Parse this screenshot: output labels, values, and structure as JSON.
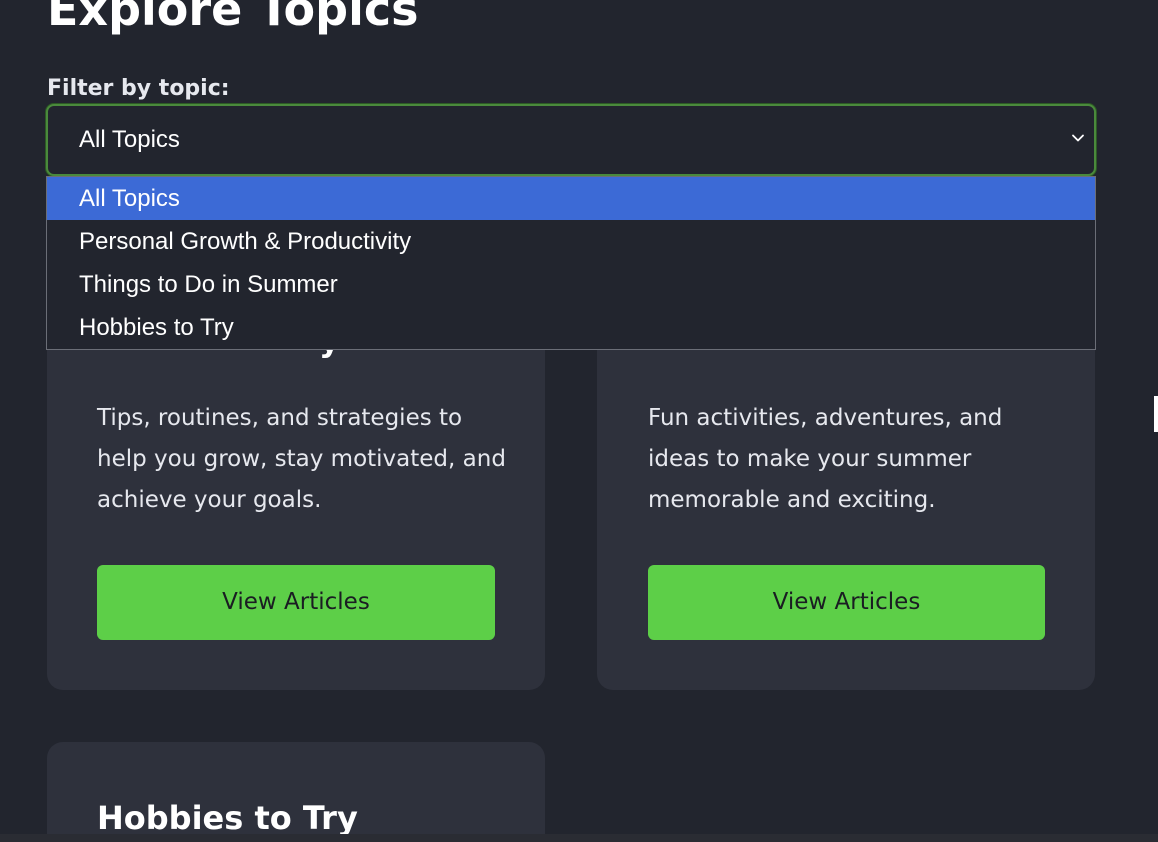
{
  "page": {
    "title": "Explore Topics"
  },
  "filter": {
    "label": "Filter by topic:",
    "selected_value": "All Topics",
    "options": [
      "All Topics",
      "Personal Growth & Productivity",
      "Things to Do in Summer",
      "Hobbies to Try"
    ]
  },
  "cards": [
    {
      "description_lines": [
        "Tips, routines, and strategies to",
        "help you grow, stay motivated, and",
        "achieve your goals."
      ],
      "button_label": "View Articles"
    },
    {
      "description_lines": [
        "Fun activities, adventures, and",
        "ideas to make your summer",
        "memorable and exciting."
      ],
      "button_label": "View Articles"
    },
    {
      "title": "Hobbies to Try"
    }
  ],
  "colors": {
    "background": "#22252e",
    "card": "#2e313c",
    "accent_button": "#5dcf48",
    "selected_option": "#3c6ad6",
    "focus_border": "#4a8a3c"
  },
  "icons": {
    "select_chevron": "chevron-down-icon"
  }
}
